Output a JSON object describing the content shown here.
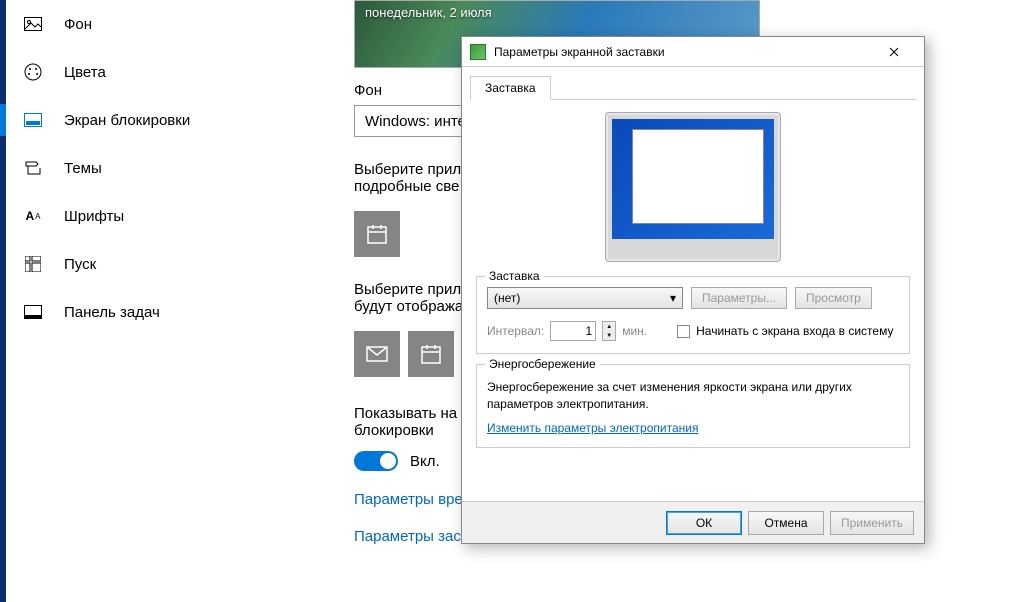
{
  "sidebar": {
    "items": [
      {
        "label": "Фон",
        "icon": "image-icon"
      },
      {
        "label": "Цвета",
        "icon": "palette-icon"
      },
      {
        "label": "Экран блокировки",
        "icon": "lock-screen-icon"
      },
      {
        "label": "Темы",
        "icon": "theme-icon"
      },
      {
        "label": "Шрифты",
        "icon": "font-icon"
      },
      {
        "label": "Пуск",
        "icon": "start-icon"
      },
      {
        "label": "Панель задач",
        "icon": "taskbar-icon"
      }
    ]
  },
  "main": {
    "preview_date": "понедельник, 2 июля",
    "heading_background": "Фон",
    "dropdown_value": "Windows: инте",
    "choose_app_text1": "Выберите прило",
    "choose_app_text1b": "подробные све",
    "choose_app_text2": "Выберите прило",
    "choose_app_text2b": "будут отобража",
    "show_on_lock_text": "Показывать на э",
    "show_on_lock_text2": "блокировки",
    "toggle_label": "Вкл.",
    "link_time": "Параметры вре",
    "link_screensaver": "Параметры заставки"
  },
  "dialog": {
    "title": "Параметры экранной заставки",
    "tab": "Заставка",
    "group_screensaver": "Заставка",
    "combo_value": "(нет)",
    "btn_params": "Параметры...",
    "btn_preview": "Просмотр",
    "interval_label": "Интервал:",
    "interval_value": "1",
    "interval_unit": "мин.",
    "checkbox_label": "Начинать с экрана входа в систему",
    "group_energy": "Энергосбережение",
    "energy_text": "Энергосбережение за счет изменения яркости экрана или других параметров электропитания.",
    "energy_link": "Изменить параметры электропитания",
    "btn_ok": "ОК",
    "btn_cancel": "Отмена",
    "btn_apply": "Применить"
  }
}
